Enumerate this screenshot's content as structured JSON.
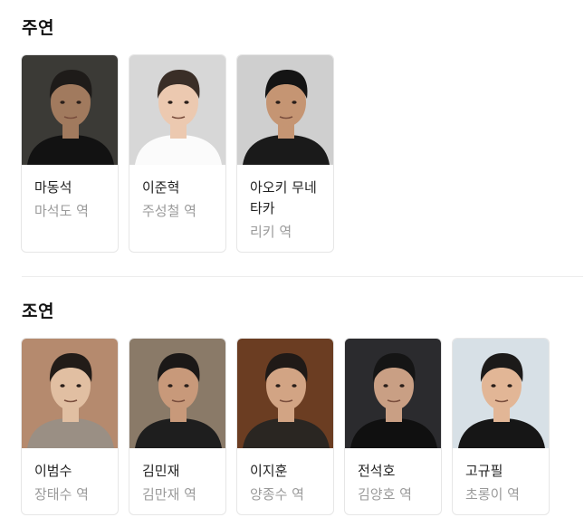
{
  "lead": {
    "title": "주연",
    "cast": [
      {
        "name": "마동석",
        "role": "마석도 역",
        "icon": "actor-photo",
        "bg": "#3b3a36",
        "skin": "#a17a5e",
        "hair": "#1e1b19",
        "shirt": "#121212"
      },
      {
        "name": "이준혁",
        "role": "주성철 역",
        "icon": "actor-photo",
        "bg": "#d7d7d7",
        "skin": "#ecc9b0",
        "hair": "#3a2e27",
        "shirt": "#fbfbfb"
      },
      {
        "name": "아오키 무네타카",
        "role": "리키 역",
        "icon": "actor-photo",
        "bg": "#cfcfcf",
        "skin": "#c59573",
        "hair": "#141414",
        "shirt": "#1a1a1a"
      }
    ]
  },
  "supporting": {
    "title": "조연",
    "cast": [
      {
        "name": "이범수",
        "role": "장태수 역",
        "icon": "actor-photo",
        "bg": "#b58a6e",
        "skin": "#e1bfa2",
        "hair": "#221c18",
        "shirt": "#9a8f84"
      },
      {
        "name": "김민재",
        "role": "김만재 역",
        "icon": "actor-photo",
        "bg": "#8a7a68",
        "skin": "#c8997a",
        "hair": "#1b1817",
        "shirt": "#1e1e1e"
      },
      {
        "name": "이지훈",
        "role": "양종수 역",
        "icon": "actor-photo",
        "bg": "#6b3d22",
        "skin": "#d2a484",
        "hair": "#201a17",
        "shirt": "#2a2622"
      },
      {
        "name": "전석호",
        "role": "김양호 역",
        "icon": "actor-photo",
        "bg": "#2b2b2e",
        "skin": "#c99f84",
        "hair": "#151515",
        "shirt": "#101010"
      },
      {
        "name": "고규필",
        "role": "초롱이 역",
        "icon": "actor-photo",
        "bg": "#d7e0e6",
        "skin": "#e2b696",
        "hair": "#1c1a19",
        "shirt": "#161616"
      }
    ]
  }
}
